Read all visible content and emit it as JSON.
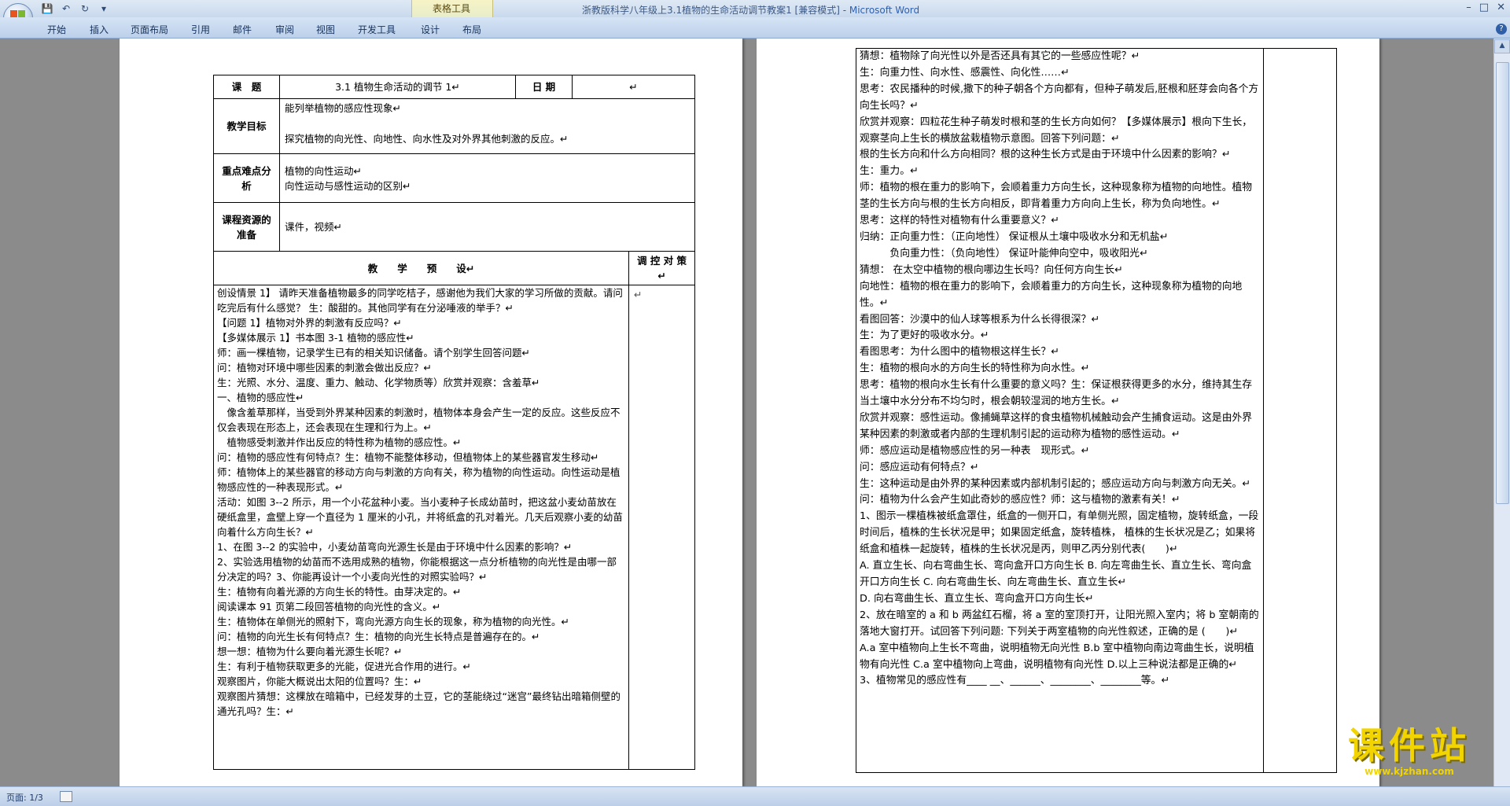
{
  "window": {
    "title": "浙教版科学八年级上3.1植物的生命活动调节教案1 [兼容模式] - ",
    "app_name": "Microsoft Word",
    "context_tab_group": "表格工具"
  },
  "quick_access": {
    "save": "💾",
    "undo": "↶",
    "redo": "↻",
    "customize": "▾"
  },
  "window_controls": {
    "minimize": "–",
    "restore": "□",
    "close": "✕"
  },
  "ribbon": {
    "tabs": [
      "开始",
      "插入",
      "页面布局",
      "引用",
      "邮件",
      "审阅",
      "视图",
      "开发工具",
      "设计",
      "布局"
    ],
    "help": "?"
  },
  "page1": {
    "header": {
      "topic_label": "课　题",
      "topic_value": "3.1 植物生命活动的调节 1↵",
      "date_label": "日 期",
      "date_value": "↵"
    },
    "goals": {
      "label": "教学目标",
      "lines": [
        "能列举植物的感应性现象↵",
        "探究植物的向光性、向地性、向水性及对外界其他刺激的反应。↵"
      ]
    },
    "focus": {
      "label": "重点难点分析",
      "lines": [
        "植物的向性运动↵",
        "向性运动与感性运动的区别↵"
      ]
    },
    "resources": {
      "label": "课程资源的准备",
      "value": "课件，视频↵"
    },
    "preview_label": "教　　学　　预　　设↵",
    "control_label": "调 控 对 策↵",
    "side_mark": "↵",
    "body": [
      "创设情景 1】 请昨天准备植物最多的同学吃桔子，感谢他为我们大家的学习所做的贡献。请问吃完后有什么感觉？ 生：酸甜的。其他同学有在分泌唾液的举手？↵",
      "【问题 1】植物对外界的刺激有反应吗？↵",
      "【多媒体展示 1】书本图 3-1 植物的感应性↵",
      "师：画一棵植物，记录学生已有的相关知识储备。请个别学生回答问题↵",
      "问：植物对环境中哪些因素的刺激会做出反应？↵",
      "生：光照、水分、温度、重力、触动、化学物质等）欣赏并观察：含羞草↵",
      "一、植物的感应性↵",
      "　像含羞草那样，当受到外界某种因素的刺激时，植物体本身会产生一定的反应。这些反应不仅会表现在形态上，还会表现在生理和行为上。↵",
      "　植物感受刺激并作出反应的特性称为植物的感应性。↵",
      "问：植物的感应性有何特点？生：植物不能整体移动，但植物体上的某些器官发生移动↵",
      "师：植物体上的某些器官的移动方向与刺激的方向有关，称为植物的向性运动。向性运动是植物感应性的一种表现形式。↵",
      "活动：如图 3--2 所示，用一个小花盆种小麦。当小麦种子长成幼苗时，把这盆小麦幼苗放在硬纸盒里，盒壁上穿一个直径为 1 厘米的小孔，并将纸盒的孔对着光。几天后观察小麦的幼苗向着什么方向生长？↵",
      "1、在图 3--2 的实验中，小麦幼苗弯向光源生长是由于环境中什么因素的影响？↵",
      "2、实验选用植物的幼苗而不选用成熟的植物，你能根据这一点分析植物的向光性是由哪一部分决定的吗？3、你能再设计一个小麦向光性的对照实验吗？↵",
      "生：植物有向着光源的方向生长的特性。由芽决定的。↵",
      "阅读课本 91 页第二段回答植物的向光性的含义。↵",
      "生：植物体在单侧光的照射下，弯向光源方向生长的现象，称为植物的向光性。↵",
      "问：植物的向光生长有何特点？生：植物的向光生长特点是普遍存在的。↵",
      "想一想：植物为什么要向着光源生长呢？↵",
      "生：有利于植物获取更多的光能，促进光合作用的进行。↵",
      "观察图片，你能大概说出太阳的位置吗？生：↵",
      "观察图片猜想：这棵放在暗箱中，已经发芽的土豆，它的茎能绕过“迷宫”最终钻出暗箱侧壁的通光孔吗？生：↵"
    ]
  },
  "page2": {
    "body": [
      "猜想：植物除了向光性以外是否还具有其它的一些感应性呢？↵",
      "生：向重力性、向水性、感震性、向化性……↵",
      "思考：农民播种的时候,撒下的种子朝各个方向都有，但种子萌发后,胚根和胚芽会向各个方向生长吗？↵",
      "欣赏并观察：四粒花生种子萌发时根和茎的生长方向如何？【多媒体展示】根向下生长，观察茎向上生长的横放盆栽植物示意图。回答下列问题：↵",
      "根的生长方向和什么方向相同？根的这种生长方式是由于环境中什么因素的影响？↵",
      "生：重力。↵",
      "师：植物的根在重力的影响下，会顺着重力方向生长，这种现象称为植物的向地性。植物茎的生长方向与根的生长方向相反，即背着重力方向向上生长，称为负向地性。↵",
      "思考：这样的特性对植物有什么重要意义？↵",
      "归纳：正向重力性：（正向地性） 保证根从土壤中吸收水分和无机盐↵",
      "　　　负向重力性：（负向地性） 保证叶能伸向空中，吸收阳光↵",
      "猜想： 在太空中植物的根向哪边生长吗？向任何方向生长↵",
      "向地性：植物的根在重力的影响下，会顺着重力的方向生长，这种现象称为植物的向地性。↵",
      "看图回答：沙漠中的仙人球等根系为什么长得很深？↵",
      "生：为了更好的吸收水分。↵",
      "看图思考：为什么图中的植物根这样生长？↵",
      "生：植物的根向水的方向生长的特性称为向水性。↵",
      "思考：植物的根向水生长有什么重要的意义吗？生：保证根获得更多的水分，维持其生存当土壤中水分分布不均匀时，根会朝较湿润的地方生长。↵",
      "欣赏并观察：感性运动。像捕蝇草这样的食虫植物机械触动会产生捕食运动。这是由外界某种因素的刺激或者内部的生理机制引起的运动称为植物的感性运动。↵",
      "师：感应运动是植物感应性的另一种表　现形式。↵",
      "问：感应运动有何特点？↵",
      "生：这种运动是由外界的某种因素或内部机制引起的；感应运动方向与刺激方向无关。↵",
      "问：植物为什么会产生如此奇妙的感应性？师：这与植物的激素有关！↵",
      "1、图示一棵植株被纸盒罩住，纸盒的一侧开口，有单侧光照，固定植物，旋转纸盒，一段时间后，植株的生长状况是甲；如果固定纸盒，旋转植株， 植株的生长状况是乙；如果将纸盒和植株一起旋转，植株的生长状况是丙，则甲乙丙分别代表(　　)↵",
      "A. 直立生长、向右弯曲生长、弯向盒开口方向生长 B. 向左弯曲生长、直立生长、弯向盒开口方向生长 C. 向右弯曲生长、向左弯曲生长、直立生长↵",
      "D. 向右弯曲生长、直立生长、弯向盒开口方向生长↵",
      "2、放在暗室的 a 和 b 两盆红石榴，将 a 室的室顶打开，让阳光照入室内；将 b 室朝南的落地大窗打开。试回答下列问题: 下列关于两室植物的向光性叙述，正确的是 (　　)↵",
      "A.a 室中植物向上生长不弯曲，说明植物无向光性 B.b 室中植物向南边弯曲生长，说明植物有向光性 C.a 室中植物向上弯曲，说明植物有向光性 D.以上三种说法都是正确的↵",
      "3、植物常见的感应性有____ __、______、________、________等。↵"
    ],
    "side_mark": ""
  },
  "status": {
    "page_info": "页面: 1/3"
  },
  "watermark": {
    "big": "课件站",
    "small": "www.kjzhan.com"
  },
  "colors": {
    "ribbon": "#c9d9ed",
    "accent": "#2f5fa7",
    "watermark": "#f1d400",
    "workspace": "#8b8b8b"
  }
}
